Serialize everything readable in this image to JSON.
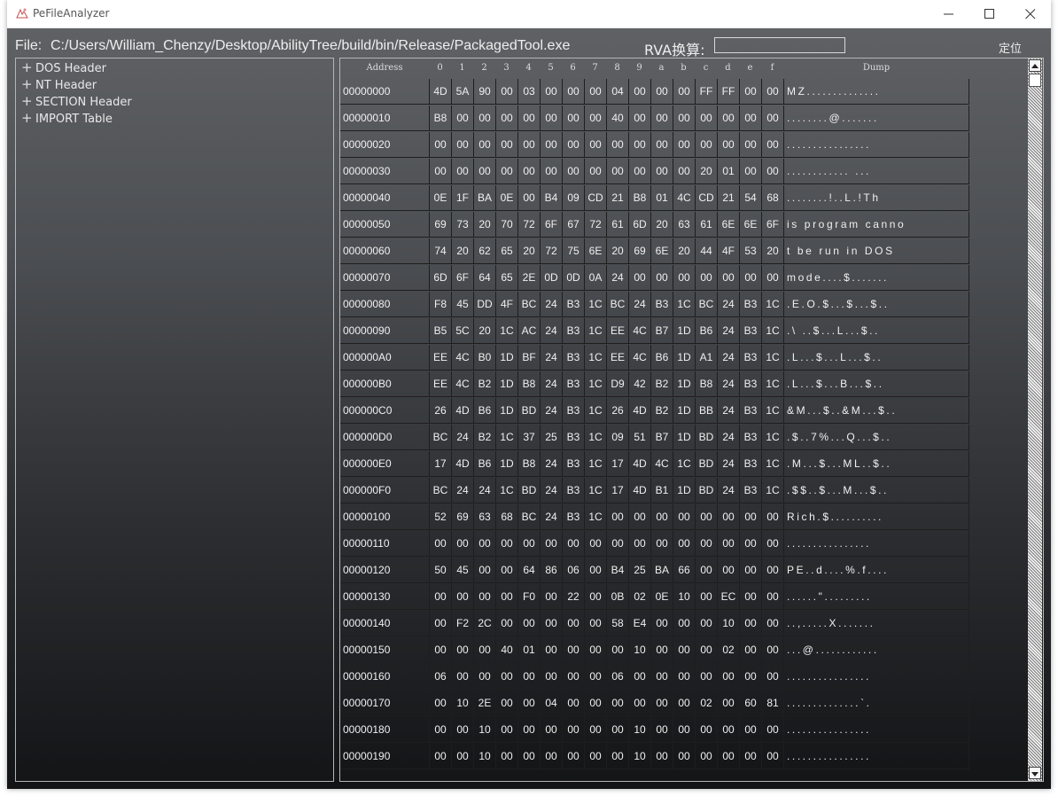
{
  "window": {
    "title": "PeFileAnalyzer"
  },
  "toolbar": {
    "file_label": "File:",
    "file_path": "C:/Users/William_Chenzy/Desktop/AbilityTree/build/bin/Release/PackagedTool.exe",
    "rva_label": "RVA换算:",
    "rva_value": "",
    "locate_label": "定位"
  },
  "tree": {
    "items": [
      {
        "label": "DOS Header"
      },
      {
        "label": "NT Header"
      },
      {
        "label": "SECTION Header"
      },
      {
        "label": "IMPORT Table"
      }
    ]
  },
  "hex": {
    "header": {
      "address": "Address",
      "cols": [
        "0",
        "1",
        "2",
        "3",
        "4",
        "5",
        "6",
        "7",
        "8",
        "9",
        "a",
        "b",
        "c",
        "d",
        "e",
        "f"
      ],
      "dump": "Dump"
    },
    "rows": [
      {
        "addr": "00000000",
        "bytes": [
          "4D",
          "5A",
          "90",
          "00",
          "03",
          "00",
          "00",
          "00",
          "04",
          "00",
          "00",
          "00",
          "FF",
          "FF",
          "00",
          "00"
        ],
        "dump": "MZ.............."
      },
      {
        "addr": "00000010",
        "bytes": [
          "B8",
          "00",
          "00",
          "00",
          "00",
          "00",
          "00",
          "00",
          "40",
          "00",
          "00",
          "00",
          "00",
          "00",
          "00",
          "00"
        ],
        "dump": "........@......."
      },
      {
        "addr": "00000020",
        "bytes": [
          "00",
          "00",
          "00",
          "00",
          "00",
          "00",
          "00",
          "00",
          "00",
          "00",
          "00",
          "00",
          "00",
          "00",
          "00",
          "00"
        ],
        "dump": "................"
      },
      {
        "addr": "00000030",
        "bytes": [
          "00",
          "00",
          "00",
          "00",
          "00",
          "00",
          "00",
          "00",
          "00",
          "00",
          "00",
          "00",
          "20",
          "01",
          "00",
          "00"
        ],
        "dump": "............ ..."
      },
      {
        "addr": "00000040",
        "bytes": [
          "0E",
          "1F",
          "BA",
          "0E",
          "00",
          "B4",
          "09",
          "CD",
          "21",
          "B8",
          "01",
          "4C",
          "CD",
          "21",
          "54",
          "68"
        ],
        "dump": "........!..L.!Th"
      },
      {
        "addr": "00000050",
        "bytes": [
          "69",
          "73",
          "20",
          "70",
          "72",
          "6F",
          "67",
          "72",
          "61",
          "6D",
          "20",
          "63",
          "61",
          "6E",
          "6E",
          "6F"
        ],
        "dump": "is program canno"
      },
      {
        "addr": "00000060",
        "bytes": [
          "74",
          "20",
          "62",
          "65",
          "20",
          "72",
          "75",
          "6E",
          "20",
          "69",
          "6E",
          "20",
          "44",
          "4F",
          "53",
          "20"
        ],
        "dump": "t be run in DOS "
      },
      {
        "addr": "00000070",
        "bytes": [
          "6D",
          "6F",
          "64",
          "65",
          "2E",
          "0D",
          "0D",
          "0A",
          "24",
          "00",
          "00",
          "00",
          "00",
          "00",
          "00",
          "00"
        ],
        "dump": "mode....$......."
      },
      {
        "addr": "00000080",
        "bytes": [
          "F8",
          "45",
          "DD",
          "4F",
          "BC",
          "24",
          "B3",
          "1C",
          "BC",
          "24",
          "B3",
          "1C",
          "BC",
          "24",
          "B3",
          "1C"
        ],
        "dump": ".E.O.$...$...$.."
      },
      {
        "addr": "00000090",
        "bytes": [
          "B5",
          "5C",
          "20",
          "1C",
          "AC",
          "24",
          "B3",
          "1C",
          "EE",
          "4C",
          "B7",
          "1D",
          "B6",
          "24",
          "B3",
          "1C"
        ],
        "dump": ".\\ ..$...L...$.."
      },
      {
        "addr": "000000A0",
        "bytes": [
          "EE",
          "4C",
          "B0",
          "1D",
          "BF",
          "24",
          "B3",
          "1C",
          "EE",
          "4C",
          "B6",
          "1D",
          "A1",
          "24",
          "B3",
          "1C"
        ],
        "dump": ".L...$...L...$.."
      },
      {
        "addr": "000000B0",
        "bytes": [
          "EE",
          "4C",
          "B2",
          "1D",
          "B8",
          "24",
          "B3",
          "1C",
          "D9",
          "42",
          "B2",
          "1D",
          "B8",
          "24",
          "B3",
          "1C"
        ],
        "dump": ".L...$...B...$.."
      },
      {
        "addr": "000000C0",
        "bytes": [
          "26",
          "4D",
          "B6",
          "1D",
          "BD",
          "24",
          "B3",
          "1C",
          "26",
          "4D",
          "B2",
          "1D",
          "BB",
          "24",
          "B3",
          "1C"
        ],
        "dump": "&M...$..&M...$.."
      },
      {
        "addr": "000000D0",
        "bytes": [
          "BC",
          "24",
          "B2",
          "1C",
          "37",
          "25",
          "B3",
          "1C",
          "09",
          "51",
          "B7",
          "1D",
          "BD",
          "24",
          "B3",
          "1C"
        ],
        "dump": ".$..7%...Q...$.."
      },
      {
        "addr": "000000E0",
        "bytes": [
          "17",
          "4D",
          "B6",
          "1D",
          "B8",
          "24",
          "B3",
          "1C",
          "17",
          "4D",
          "4C",
          "1C",
          "BD",
          "24",
          "B3",
          "1C"
        ],
        "dump": ".M...$...ML..$.."
      },
      {
        "addr": "000000F0",
        "bytes": [
          "BC",
          "24",
          "24",
          "1C",
          "BD",
          "24",
          "B3",
          "1C",
          "17",
          "4D",
          "B1",
          "1D",
          "BD",
          "24",
          "B3",
          "1C"
        ],
        "dump": ".$$..$...M...$.."
      },
      {
        "addr": "00000100",
        "bytes": [
          "52",
          "69",
          "63",
          "68",
          "BC",
          "24",
          "B3",
          "1C",
          "00",
          "00",
          "00",
          "00",
          "00",
          "00",
          "00",
          "00"
        ],
        "dump": "Rich.$.........."
      },
      {
        "addr": "00000110",
        "bytes": [
          "00",
          "00",
          "00",
          "00",
          "00",
          "00",
          "00",
          "00",
          "00",
          "00",
          "00",
          "00",
          "00",
          "00",
          "00",
          "00"
        ],
        "dump": "................"
      },
      {
        "addr": "00000120",
        "bytes": [
          "50",
          "45",
          "00",
          "00",
          "64",
          "86",
          "06",
          "00",
          "B4",
          "25",
          "BA",
          "66",
          "00",
          "00",
          "00",
          "00"
        ],
        "dump": "PE..d....%.f...."
      },
      {
        "addr": "00000130",
        "bytes": [
          "00",
          "00",
          "00",
          "00",
          "F0",
          "00",
          "22",
          "00",
          "0B",
          "02",
          "0E",
          "10",
          "00",
          "EC",
          "00",
          "00"
        ],
        "dump": "......\"........."
      },
      {
        "addr": "00000140",
        "bytes": [
          "00",
          "F2",
          "2C",
          "00",
          "00",
          "00",
          "00",
          "00",
          "58",
          "E4",
          "00",
          "00",
          "00",
          "10",
          "00",
          "00"
        ],
        "dump": "..,.....X......."
      },
      {
        "addr": "00000150",
        "bytes": [
          "00",
          "00",
          "00",
          "40",
          "01",
          "00",
          "00",
          "00",
          "00",
          "10",
          "00",
          "00",
          "00",
          "02",
          "00",
          "00"
        ],
        "dump": "...@............"
      },
      {
        "addr": "00000160",
        "bytes": [
          "06",
          "00",
          "00",
          "00",
          "00",
          "00",
          "00",
          "00",
          "06",
          "00",
          "00",
          "00",
          "00",
          "00",
          "00",
          "00"
        ],
        "dump": "................"
      },
      {
        "addr": "00000170",
        "bytes": [
          "00",
          "10",
          "2E",
          "00",
          "00",
          "04",
          "00",
          "00",
          "00",
          "00",
          "00",
          "00",
          "02",
          "00",
          "60",
          "81"
        ],
        "dump": "..............`."
      },
      {
        "addr": "00000180",
        "bytes": [
          "00",
          "00",
          "10",
          "00",
          "00",
          "00",
          "00",
          "00",
          "00",
          "10",
          "00",
          "00",
          "00",
          "00",
          "00",
          "00"
        ],
        "dump": "................"
      },
      {
        "addr": "00000190",
        "bytes": [
          "00",
          "00",
          "10",
          "00",
          "00",
          "00",
          "00",
          "00",
          "00",
          "10",
          "00",
          "00",
          "00",
          "00",
          "00",
          "00"
        ],
        "dump": "................"
      }
    ]
  }
}
